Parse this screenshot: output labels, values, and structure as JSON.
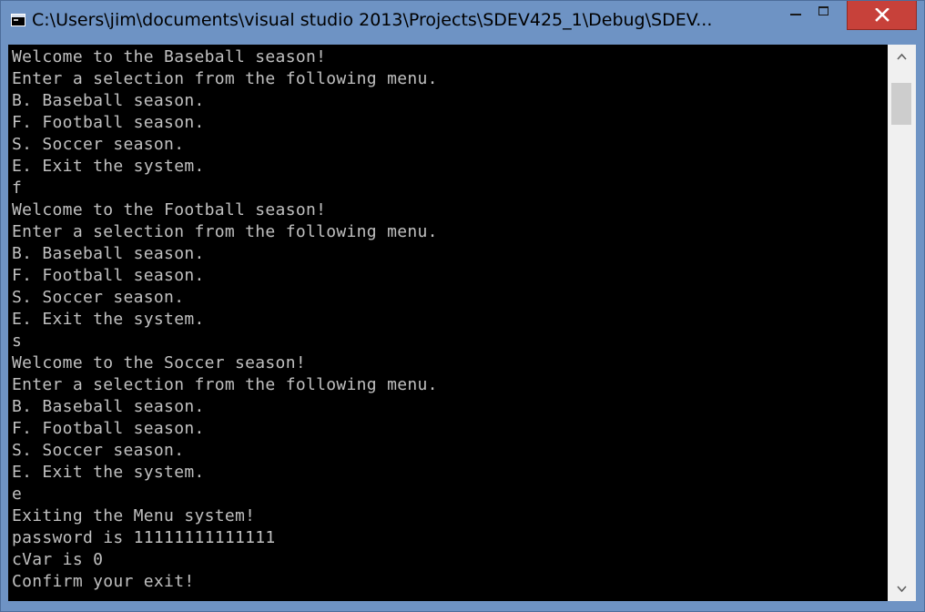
{
  "window": {
    "title": "C:\\Users\\jim\\documents\\visual studio 2013\\Projects\\SDEV425_1\\Debug\\SDEV...",
    "icon": "console-app-icon",
    "controls": {
      "minimize_icon": "minimize-icon",
      "maximize_icon": "maximize-icon",
      "close_icon": "close-icon"
    }
  },
  "console": {
    "lines": [
      "Welcome to the Baseball season!",
      "Enter a selection from the following menu.",
      "B. Baseball season.",
      "F. Football season.",
      "S. Soccer season.",
      "E. Exit the system.",
      "f",
      "Welcome to the Football season!",
      "Enter a selection from the following menu.",
      "B. Baseball season.",
      "F. Football season.",
      "S. Soccer season.",
      "E. Exit the system.",
      "s",
      "Welcome to the Soccer season!",
      "Enter a selection from the following menu.",
      "B. Baseball season.",
      "F. Football season.",
      "S. Soccer season.",
      "E. Exit the system.",
      "e",
      "Exiting the Menu system!",
      "password is 11111111111111",
      "cVar is 0",
      "Confirm your exit!"
    ]
  },
  "scrollbar": {
    "up_icon": "chevron-up-icon",
    "down_icon": "chevron-down-icon"
  },
  "colors": {
    "frame": "#6e93c4",
    "console_background": "#000000",
    "console_text": "#c0c0c0",
    "close_button": "#c7413a"
  }
}
